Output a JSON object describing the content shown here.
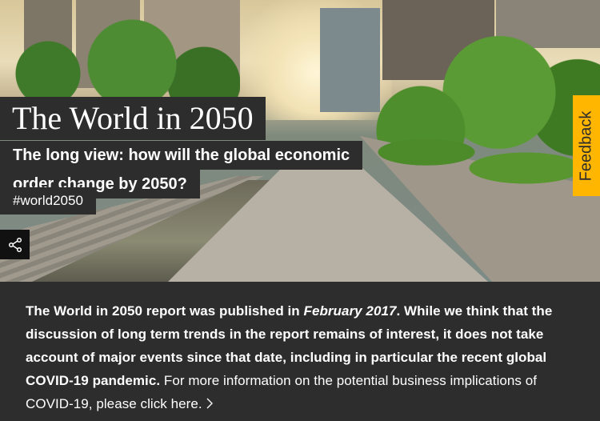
{
  "hero": {
    "title": "The World in 2050",
    "subtitle_line1": "The long view: how will the global economic",
    "subtitle_line2": "order change by 2050?",
    "hashtag": "#world2050",
    "share_icon": "share-icon",
    "feedback_label": "Feedback"
  },
  "notice": {
    "part1": "The World in 2050 report was published in ",
    "date": "February 2017",
    "part2": ". While we think that the discussion of long term trends in the report remains of interest, it does not take account of major events since that date, including in particular the recent global COVID-19 pandemic.",
    "part3": " For more information on the potential business implications of COVID-19, please ",
    "link_text": "click here.",
    "link_icon": "chevron-right-icon"
  },
  "colors": {
    "panel": "#2d2d2d",
    "feedback": "#ffb600",
    "text": "#ffffff"
  }
}
